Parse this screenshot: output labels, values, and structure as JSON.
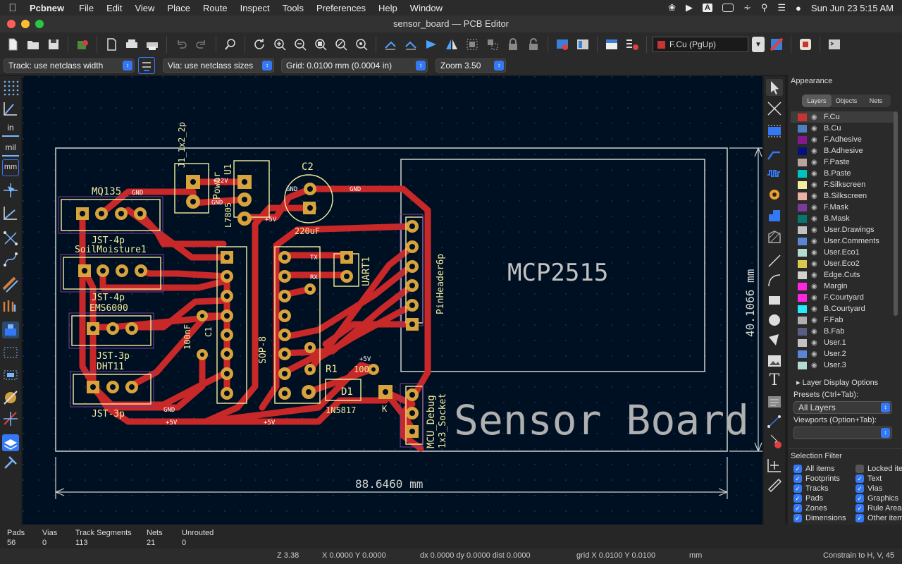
{
  "menubar": {
    "app": "Pcbnew",
    "items": [
      "File",
      "Edit",
      "View",
      "Place",
      "Route",
      "Inspect",
      "Tools",
      "Preferences",
      "Help",
      "Window"
    ],
    "clock": "Sun Jun 23  5:15 AM",
    "input_indicator": "A"
  },
  "window": {
    "title": "sensor_board — PCB Editor"
  },
  "toolbar": {
    "active_layer": "F.Cu (PgUp)",
    "active_layer_color": "#c83434",
    "icons": [
      "new-board-icon",
      "open-icon",
      "save-icon",
      "board-setup-icon",
      "page-settings-icon",
      "print-icon",
      "plot-icon",
      "undo-icon",
      "redo-icon",
      "find-icon",
      "refresh-icon",
      "zoom-in-icon",
      "zoom-out-icon",
      "zoom-fit-icon",
      "zoom-objects-icon",
      "zoom-selection-icon",
      "rotate-ccw-icon",
      "rotate-cw-icon",
      "flip-icon",
      "mirror-icon",
      "group-icon",
      "ungroup-icon",
      "lock-icon",
      "unlock-icon",
      "update-pcb-icon",
      "footprint-library-icon",
      "netlist-icon",
      "drc-icon",
      "layer-pair-icon",
      "scripting-icon",
      "python-console-icon"
    ]
  },
  "options": {
    "track": "Track: use netclass width",
    "via": "Via: use netclass sizes",
    "grid": "Grid: 0.0100 mm (0.0004 in)",
    "zoom": "Zoom 3.50"
  },
  "left_tools": [
    "grid-toggle-icon",
    "polar-coords-icon",
    "inches-icon",
    "mils-icon",
    "millimeters-icon",
    "cursor-crosshair-icon",
    "measure-icon",
    "ratsnest-icon",
    "curved-ratsnest-icon",
    "via-display-icon",
    "track-outline-icon",
    "high-contrast-icon",
    "outline-zones-icon",
    "footprint-outline-icon",
    "show-pads-icon",
    "layers-manager-icon",
    "properties-icon"
  ],
  "left_tool_labels": {
    "inches": "in",
    "mils": "mil",
    "millimeters": "mm"
  },
  "right_tools": [
    "select-icon",
    "local-ratsnest-icon",
    "add-footprint-icon",
    "route-track-icon",
    "tune-length-icon",
    "add-via-icon",
    "add-zone-icon",
    "add-rule-area-icon",
    "draw-line-icon",
    "draw-arc-icon",
    "draw-rectangle-icon",
    "draw-circle-icon",
    "draw-polygon-icon",
    "add-image-icon",
    "add-text-icon",
    "add-textbox-icon",
    "add-dimension-icon",
    "delete-icon",
    "set-origin-icon",
    "measure-tool-icon"
  ],
  "right_tool_labels": {
    "text": "T"
  },
  "board": {
    "title_text": "Sensor Board",
    "module_text": "MCP2515",
    "dim_horizontal": "88.6460 mm",
    "dim_vertical": "40.1066 mm",
    "labels": [
      "MQ135",
      "J1_1x2_2p",
      "Power",
      "U1",
      "L7805",
      "C2",
      "220uF",
      "JST-4p",
      "SoilMoisture1",
      "EMS6000",
      "JST-3p",
      "DHT11",
      "UART1",
      "PinHeader6p",
      "R1",
      "100",
      "D1",
      "1N5817",
      "K",
      "MCU_Debug",
      "1x3_Socket",
      "SOP-8",
      "100nF",
      "C1"
    ],
    "net_labels": [
      "GND",
      "+12V",
      "+5V",
      "TX",
      "RX"
    ]
  },
  "appearance": {
    "title": "Appearance",
    "tabs": [
      "Layers",
      "Objects",
      "Nets"
    ],
    "layers": [
      {
        "name": "F.Cu",
        "color": "#c83434"
      },
      {
        "name": "B.Cu",
        "color": "#4d7fc4"
      },
      {
        "name": "F.Adhesive",
        "color": "#84198f"
      },
      {
        "name": "B.Adhesive",
        "color": "#05117e"
      },
      {
        "name": "F.Paste",
        "color": "#b8a59f"
      },
      {
        "name": "B.Paste",
        "color": "#00c2c2"
      },
      {
        "name": "F.Silkscreen",
        "color": "#f2eda1"
      },
      {
        "name": "B.Silkscreen",
        "color": "#e8b2a7"
      },
      {
        "name": "F.Mask",
        "color": "#7b3b99"
      },
      {
        "name": "B.Mask",
        "color": "#06766f"
      },
      {
        "name": "User.Drawings",
        "color": "#c2c2c2"
      },
      {
        "name": "User.Comments",
        "color": "#5985d6"
      },
      {
        "name": "User.Eco1",
        "color": "#b4dbd2"
      },
      {
        "name": "User.Eco2",
        "color": "#d8c852"
      },
      {
        "name": "Edge.Cuts",
        "color": "#d0d2cd"
      },
      {
        "name": "Margin",
        "color": "#ff26e2"
      },
      {
        "name": "F.Courtyard",
        "color": "#ff26e2"
      },
      {
        "name": "B.Courtyard",
        "color": "#26e9ff"
      },
      {
        "name": "F.Fab",
        "color": "#afafaf"
      },
      {
        "name": "B.Fab",
        "color": "#585d84"
      },
      {
        "name": "User.1",
        "color": "#c2c2c2"
      },
      {
        "name": "User.2",
        "color": "#5985d6"
      },
      {
        "name": "User.3",
        "color": "#b4dbd2"
      }
    ],
    "layer_display_options": "Layer Display Options",
    "presets_label": "Presets (Ctrl+Tab):",
    "presets_value": "All Layers",
    "viewports_label": "Viewports (Option+Tab):",
    "viewports_value": ""
  },
  "selection_filter": {
    "title": "Selection Filter",
    "items": [
      {
        "label": "All items",
        "checked": true
      },
      {
        "label": "Locked items",
        "checked": false
      },
      {
        "label": "Footprints",
        "checked": true
      },
      {
        "label": "Text",
        "checked": true
      },
      {
        "label": "Tracks",
        "checked": true
      },
      {
        "label": "Vias",
        "checked": true
      },
      {
        "label": "Pads",
        "checked": true
      },
      {
        "label": "Graphics",
        "checked": true
      },
      {
        "label": "Zones",
        "checked": true
      },
      {
        "label": "Rule Areas",
        "checked": true
      },
      {
        "label": "Dimensions",
        "checked": true
      },
      {
        "label": "Other items",
        "checked": true
      }
    ]
  },
  "messages": {
    "pads_label": "Pads",
    "pads": "56",
    "vias_label": "Vias",
    "vias": "0",
    "tracks_label": "Track Segments",
    "tracks": "113",
    "nets_label": "Nets",
    "nets": "21",
    "unrouted_label": "Unrouted",
    "unrouted": "0"
  },
  "status": {
    "zoom": "Z 3.38",
    "cursor": "X 0.0000  Y 0.0000",
    "delta": "dx 0.0000  dy 0.0000  dist 0.0000",
    "grid": "grid X 0.0100  Y 0.0100",
    "units": "mm",
    "constraint": "Constrain to H, V, 45"
  }
}
